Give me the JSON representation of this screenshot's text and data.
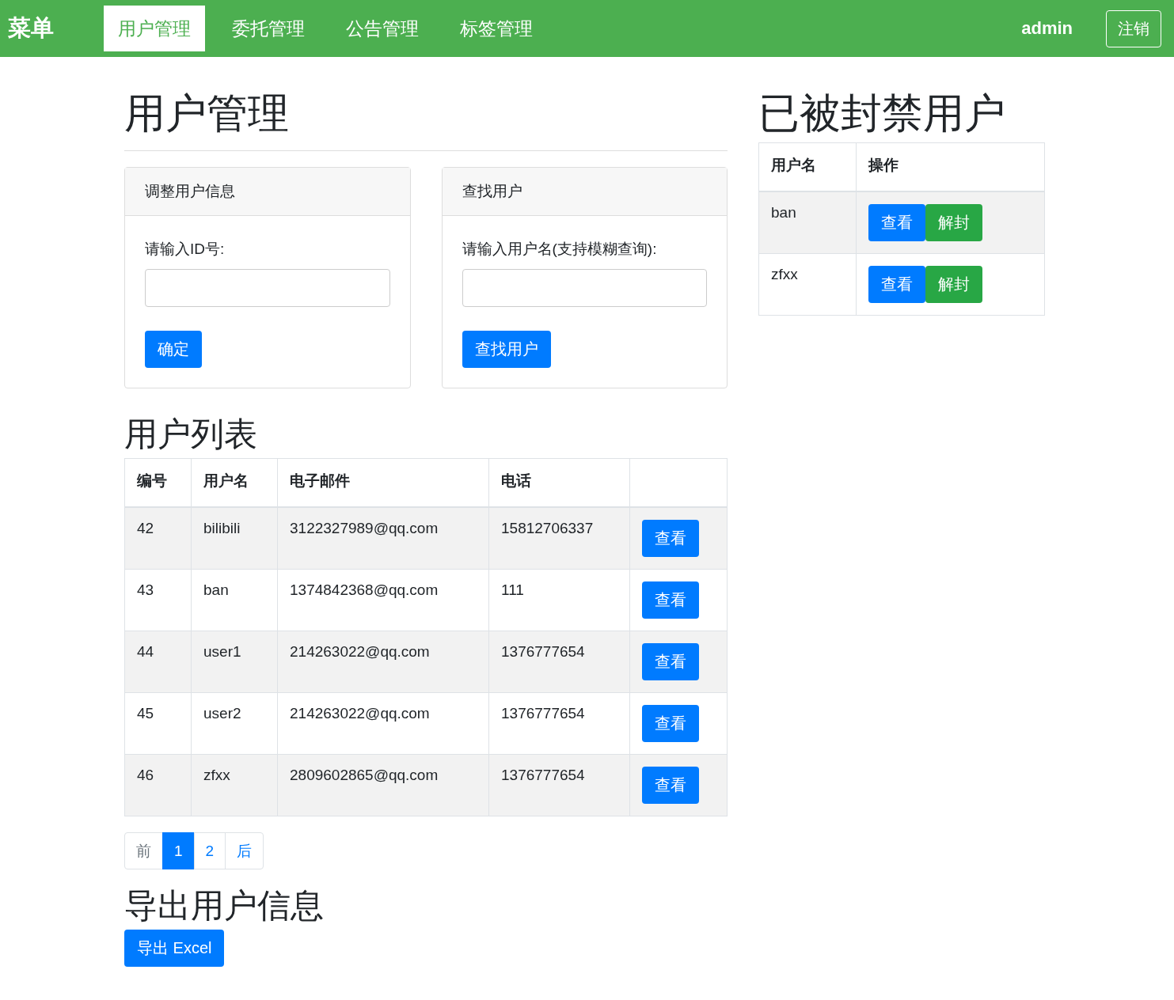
{
  "nav": {
    "brand": "菜单",
    "items": [
      {
        "label": "用户管理",
        "selected": true
      },
      {
        "label": "委托管理",
        "selected": false
      },
      {
        "label": "公告管理",
        "selected": false
      },
      {
        "label": "标签管理",
        "selected": false
      }
    ],
    "user": "admin",
    "logout": "注销"
  },
  "main": {
    "title": "用户管理",
    "cards": [
      {
        "header": "调整用户信息",
        "label": "请输入ID号:",
        "button": "确定"
      },
      {
        "header": "查找用户",
        "label": "请输入用户名(支持模糊查询):",
        "button": "查找用户"
      }
    ],
    "user_list": {
      "title": "用户列表",
      "columns": [
        "编号",
        "用户名",
        "电子邮件",
        "电话"
      ],
      "rows": [
        {
          "cells": [
            "42",
            "bilibili",
            "3122327989@qq.com",
            "15812706337"
          ],
          "button": "查看"
        },
        {
          "cells": [
            "43",
            "ban",
            "1374842368@qq.com",
            "111"
          ],
          "button": "查看"
        },
        {
          "cells": [
            "44",
            "user1",
            "214263022@qq.com",
            "1376777654"
          ],
          "button": "查看"
        },
        {
          "cells": [
            "45",
            "user2",
            "214263022@qq.com",
            "1376777654"
          ],
          "button": "查看"
        },
        {
          "cells": [
            "46",
            "zfxx",
            "2809602865@qq.com",
            "1376777654"
          ],
          "button": "查看"
        }
      ]
    },
    "pagination": [
      {
        "label": "前",
        "selected": false,
        "disabled": true
      },
      {
        "label": "1",
        "selected": true,
        "disabled": false
      },
      {
        "label": "2",
        "selected": false,
        "disabled": false
      },
      {
        "label": "后",
        "selected": false,
        "disabled": false
      }
    ],
    "export": {
      "title": "导出用户信息",
      "button": "导出 Excel"
    }
  },
  "banned": {
    "title": "已被封禁用户",
    "columns": [
      "用户名",
      "操作"
    ],
    "rows": [
      {
        "username": "ban",
        "view": "查看",
        "unban": "解封"
      },
      {
        "username": "zfxx",
        "view": "查看",
        "unban": "解封"
      }
    ]
  }
}
